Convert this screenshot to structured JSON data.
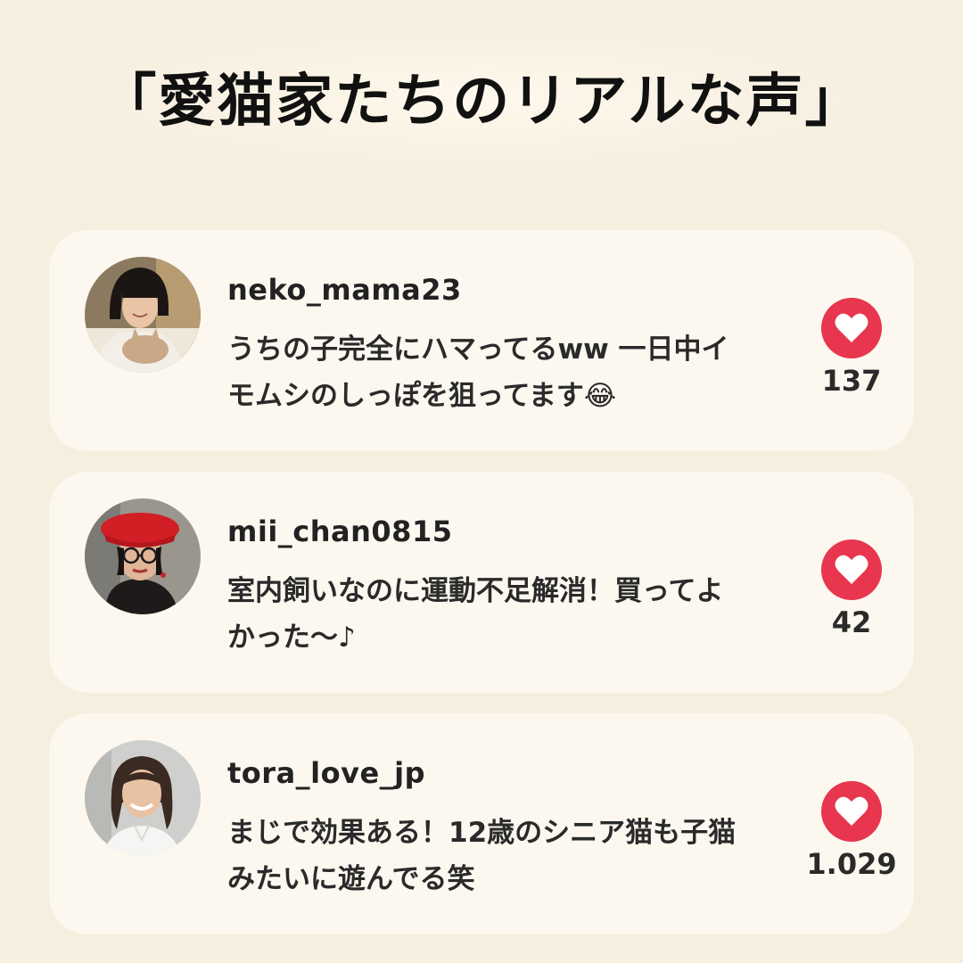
{
  "title": "「愛猫家たちのリアルな声」",
  "reviews": [
    {
      "username": "neko_mama23",
      "comment": "うちの子完全にハマってるww 一日中イモムシのしっぽを狙ってます😂",
      "likes": "137",
      "avatar": "avatar-woman-with-cat"
    },
    {
      "username": "mii_chan0815",
      "comment": "室内飼いなのに運動不足解消！買ってよかった〜♪",
      "likes": "42",
      "avatar": "avatar-woman-red-beret-glasses"
    },
    {
      "username": "tora_love_jp",
      "comment": "まじで効果ある！12歳のシニア猫も子猫みたいに遊んでる笑",
      "likes": "1.029",
      "avatar": "avatar-smiling-woman"
    }
  ],
  "colors": {
    "background": "#f6eedf",
    "card": "#fcf8ef",
    "like": "#e8364f"
  },
  "icons": {
    "like": "heart-icon"
  }
}
